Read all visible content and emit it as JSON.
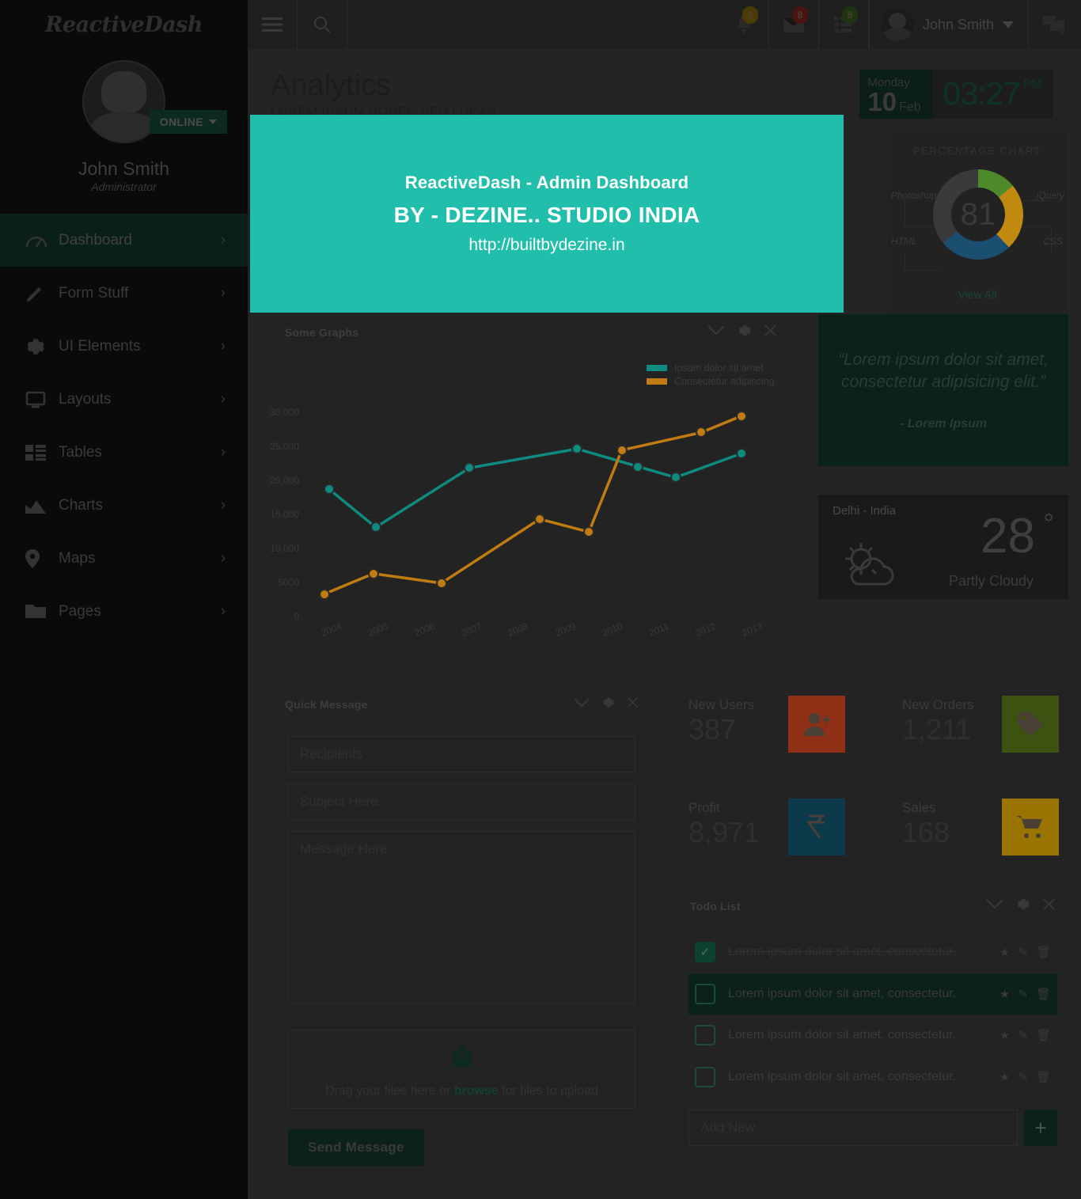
{
  "brand": {
    "name": "ReactiveDash"
  },
  "sidebar": {
    "profile": {
      "status": "ONLINE",
      "name": "John Smith",
      "role": "Administrator"
    },
    "items": [
      {
        "label": "Dashboard",
        "icon": "speedometer-icon",
        "active": true
      },
      {
        "label": "Form Stuff",
        "icon": "pencil-icon",
        "active": false
      },
      {
        "label": "UI Elements",
        "icon": "gear-icon",
        "active": false
      },
      {
        "label": "Layouts",
        "icon": "monitor-icon",
        "active": false
      },
      {
        "label": "Tables",
        "icon": "table-icon",
        "active": false
      },
      {
        "label": "Charts",
        "icon": "chart-icon",
        "active": false
      },
      {
        "label": "Maps",
        "icon": "map-pin-icon",
        "active": false
      },
      {
        "label": "Pages",
        "icon": "folder-icon",
        "active": false
      }
    ]
  },
  "topbar": {
    "menu_icon": "hamburger-icon",
    "search_icon": "search-icon",
    "notifications": {
      "icon": "bell-icon",
      "badge": "8",
      "badge_color": "#c8a415"
    },
    "messages": {
      "icon": "envelope-icon",
      "badge": "8",
      "badge_color": "#c6382f"
    },
    "tasks": {
      "icon": "tasks-icon",
      "badge": "8",
      "badge_color": "#4e8a2a"
    },
    "user_name": "John Smith",
    "user_caret": "chevron-down-icon",
    "chat_icon": "chat-bubbles-icon"
  },
  "page": {
    "title": "Analytics",
    "subtitle": "LOREM IPSUM DONEC SED LUCAS"
  },
  "clock": {
    "day": "Monday",
    "date": "10",
    "month": "Feb",
    "time": "03:27",
    "meridiem": "PM"
  },
  "percentage_chart": {
    "title": "PERCENTAGE CHART",
    "value": "81",
    "view_all": "View All",
    "labels": {
      "photoshop": "Photoshop",
      "jquery": "jQuery",
      "html": "HTML",
      "css": "CSS"
    },
    "segments": [
      {
        "name": "jQuery",
        "color": "#4e8a2a",
        "percent": 14
      },
      {
        "name": "CSS",
        "color": "#c08a10",
        "percent": 24
      },
      {
        "name": "HTML",
        "color": "#1b4f72",
        "percent": 26
      },
      {
        "name": "Photoshop",
        "color": "#3a3a3a",
        "percent": 36
      }
    ]
  },
  "graphs_panel": {
    "title": "Some Graphs",
    "actions": [
      "chevron-down-icon",
      "gear-icon",
      "close-icon"
    ]
  },
  "chart_data": {
    "type": "line",
    "title": "Some Graphs",
    "xlabel": "",
    "ylabel": "",
    "x": [
      "2004",
      "2005",
      "2006",
      "2007",
      "2008",
      "2009",
      "2010",
      "2011",
      "2012",
      "2013"
    ],
    "ytick_labels": [
      "0",
      "5000",
      "10,000",
      "15,000",
      "20,000",
      "25,000",
      "30,000"
    ],
    "ylim": [
      0,
      31000
    ],
    "grid": true,
    "legend_position": "top-right",
    "series": [
      {
        "name": "Ipsum dolor sit amet",
        "color": "#0d8b7f",
        "values": [
          18700,
          13100,
          21800,
          24600,
          22000,
          20400,
          23900,
          null,
          null,
          null
        ],
        "points": [
          {
            "x": 0.5,
            "y": 18700
          },
          {
            "x": 1.5,
            "y": 13100
          },
          {
            "x": 3.5,
            "y": 21800
          },
          {
            "x": 5.8,
            "y": 24600
          },
          {
            "x": 7.1,
            "y": 22000
          },
          {
            "x": 7.9,
            "y": 20400
          },
          {
            "x": 9.3,
            "y": 23900
          }
        ]
      },
      {
        "name": "Consectetur adipiscing.",
        "color": "#c07c11",
        "values": [
          3300,
          6300,
          4900,
          14300,
          12400,
          24400,
          27000,
          29400,
          null,
          null
        ],
        "points": [
          {
            "x": 0.4,
            "y": 3300
          },
          {
            "x": 1.45,
            "y": 6300
          },
          {
            "x": 2.9,
            "y": 4900
          },
          {
            "x": 5.0,
            "y": 14300
          },
          {
            "x": 6.05,
            "y": 12400
          },
          {
            "x": 6.75,
            "y": 24400
          },
          {
            "x": 8.45,
            "y": 27000
          },
          {
            "x": 9.3,
            "y": 29400
          }
        ]
      }
    ]
  },
  "quote": {
    "text": "“Lorem ipsum dolor sit amet, consectetur adipisicing elit.”",
    "author": "- Lorem Ipsum"
  },
  "weather": {
    "city": "Delhi - India",
    "temp": "28",
    "degree": "°",
    "desc": "Partly Cloudy",
    "icon": "sun-cloud-icon"
  },
  "quick_message": {
    "title": "Quick Message",
    "actions": [
      "chevron-down-icon",
      "gear-icon",
      "close-icon"
    ],
    "recipients_placeholder": "Recipients",
    "subject_placeholder": "Subject Here..",
    "message_placeholder": "Message Here..",
    "dropzone": {
      "icon": "upload-icon",
      "text_before": "Drag your files here or ",
      "link": "browse",
      "text_after": " for files to upload"
    },
    "send_label": "Send Message"
  },
  "stats": [
    {
      "label": "New Users",
      "value": "387",
      "icon": "user-plus-icon",
      "color": "#8f2f16"
    },
    {
      "label": "New Orders",
      "value": "1,211",
      "icon": "tag-icon",
      "color": "#3d5111"
    },
    {
      "label": "Profit",
      "value": "8,971",
      "icon": "rupee-icon",
      "color": "#0d3a4a"
    },
    {
      "label": "Sales",
      "value": "168",
      "icon": "shopping-cart-icon",
      "color": "#9a7400"
    }
  ],
  "todo": {
    "title": "Todo List",
    "actions": [
      "chevron-down-icon",
      "gear-icon",
      "close-icon"
    ],
    "items": [
      {
        "text": "Lorem ipsum dolor sit amet, consectetur.",
        "done": true,
        "highlighted": false
      },
      {
        "text": "Lorem ipsum dolor sit amet, consectetur.",
        "done": false,
        "highlighted": true
      },
      {
        "text": "Lorem ipsum dolor sit amet, consectetur.",
        "done": false,
        "highlighted": false
      },
      {
        "text": "Lorem ipsum dolor sit amet, consectetur.",
        "done": false,
        "highlighted": false
      }
    ],
    "add_placeholder": "Add New",
    "add_icon": "plus-icon"
  },
  "overlay": {
    "line1": "ReactiveDash - Admin Dashboard",
    "line2": "BY - DEZINE.. STUDIO INDIA",
    "line3": "http://builtbydezine.in",
    "color": "#21bfab"
  }
}
